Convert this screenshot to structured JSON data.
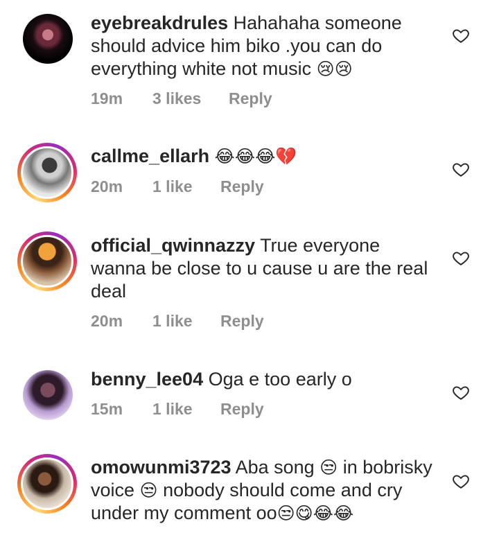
{
  "comments": [
    {
      "username": "eyebreakdrules",
      "text": "Hahahaha someone should advice him biko .you can do everything white not music",
      "emoji": "😢😢",
      "time": "19m",
      "likes": "3 likes",
      "reply": "Reply",
      "avatar_ring": false
    },
    {
      "username": "callme_ellarh",
      "text": "",
      "emoji": "😂😂😂💔",
      "time": "20m",
      "likes": "1 like",
      "reply": "Reply",
      "avatar_ring": true
    },
    {
      "username": "official_qwinnazzy",
      "text": "True everyone wanna be close to u cause u are the real deal",
      "emoji": "",
      "time": "20m",
      "likes": "1 like",
      "reply": "Reply",
      "avatar_ring": true
    },
    {
      "username": "benny_lee04",
      "text": "Oga e too early o",
      "emoji": "",
      "time": "15m",
      "likes": "1 like",
      "reply": "Reply",
      "avatar_ring": false
    },
    {
      "username": "omowunmi3723",
      "text_part1": "Aba song ",
      "emoji1": "😒",
      "text_part2": " in bobrisky voice ",
      "emoji2": "😒",
      "text_part3": " nobody should come and cry under my comment oo",
      "emoji3": "😒😋😂😂",
      "avatar_ring": true
    }
  ],
  "icons": {
    "like": "heart-outline-icon"
  },
  "colors": {
    "meta": "#8e8e8e",
    "text": "#262626"
  }
}
